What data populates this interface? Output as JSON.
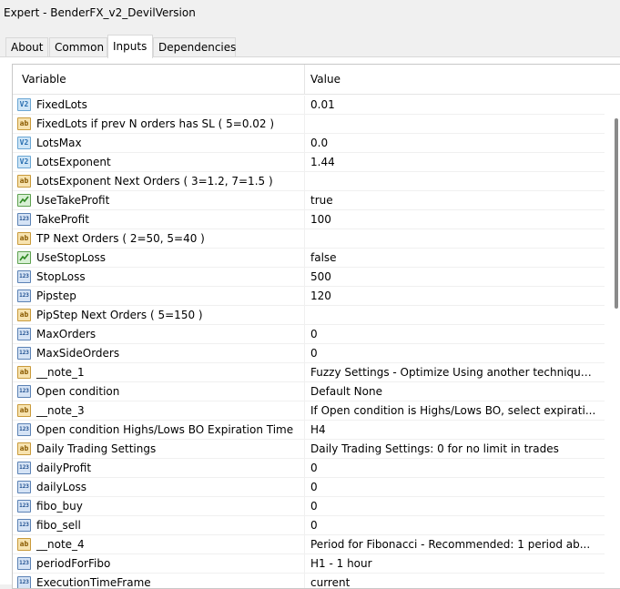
{
  "window": {
    "title": "Expert - BenderFX_v2_DevilVersion"
  },
  "tabs": [
    {
      "label": "About"
    },
    {
      "label": "Common"
    },
    {
      "label": "Inputs"
    },
    {
      "label": "Dependencies"
    }
  ],
  "active_tab": "Inputs",
  "table": {
    "headers": {
      "variable": "Variable",
      "value": "Value"
    },
    "rows": [
      {
        "icon": "double-value-icon",
        "type": "v2",
        "name": "FixedLots",
        "value": "0.01"
      },
      {
        "icon": "string-value-icon",
        "type": "ab",
        "name": "FixedLots if prev N orders has SL ( 5=0.02 )",
        "value": ""
      },
      {
        "icon": "double-value-icon",
        "type": "v2",
        "name": "LotsMax",
        "value": "0.0"
      },
      {
        "icon": "double-value-icon",
        "type": "v2",
        "name": "LotsExponent",
        "value": "1.44"
      },
      {
        "icon": "string-value-icon",
        "type": "ab",
        "name": "LotsExponent Next Orders ( 3=1.2, 7=1.5 )",
        "value": ""
      },
      {
        "icon": "bool-value-icon",
        "type": "bool",
        "name": "UseTakeProfit",
        "value": "true"
      },
      {
        "icon": "int-value-icon",
        "type": "123",
        "name": "TakeProfit",
        "value": "100"
      },
      {
        "icon": "string-value-icon",
        "type": "ab",
        "name": "TP Next Orders ( 2=50, 5=40 )",
        "value": ""
      },
      {
        "icon": "bool-value-icon",
        "type": "bool",
        "name": "UseStopLoss",
        "value": "false"
      },
      {
        "icon": "int-value-icon",
        "type": "123",
        "name": "StopLoss",
        "value": "500"
      },
      {
        "icon": "int-value-icon",
        "type": "123",
        "name": "Pipstep",
        "value": "120"
      },
      {
        "icon": "string-value-icon",
        "type": "ab",
        "name": "PipStep Next Orders ( 5=150 )",
        "value": ""
      },
      {
        "icon": "int-value-icon",
        "type": "123",
        "name": "MaxOrders",
        "value": "0"
      },
      {
        "icon": "int-value-icon",
        "type": "123",
        "name": "MaxSideOrders",
        "value": "0"
      },
      {
        "icon": "string-value-icon",
        "type": "ab",
        "name": "__note_1",
        "value": "Fuzzy Settings - Optimize Using another technique -..."
      },
      {
        "icon": "int-value-icon",
        "type": "123",
        "name": "Open condition",
        "value": "Default None"
      },
      {
        "icon": "string-value-icon",
        "type": "ab",
        "name": "__note_3",
        "value": "If Open condition is Highs/Lows BO, select expirati..."
      },
      {
        "icon": "int-value-icon",
        "type": "123",
        "name": "Open condition Highs/Lows BO Expiration Time",
        "value": "H4"
      },
      {
        "icon": "string-value-icon",
        "type": "ab",
        "name": "Daily Trading Settings",
        "value": "Daily Trading Settings: 0 for no limit in trades"
      },
      {
        "icon": "int-value-icon",
        "type": "123",
        "name": "dailyProfit",
        "value": "0"
      },
      {
        "icon": "int-value-icon",
        "type": "123",
        "name": "dailyLoss",
        "value": "0"
      },
      {
        "icon": "int-value-icon",
        "type": "123",
        "name": "fibo_buy",
        "value": "0"
      },
      {
        "icon": "int-value-icon",
        "type": "123",
        "name": "fibo_sell",
        "value": "0"
      },
      {
        "icon": "string-value-icon",
        "type": "ab",
        "name": "__note_4",
        "value": "Period for Fibonacci - Recommended: 1 period ab..."
      },
      {
        "icon": "int-value-icon",
        "type": "123",
        "name": "periodForFibo",
        "value": "H1 - 1 hour"
      },
      {
        "icon": "int-value-icon",
        "type": "123",
        "name": "ExecutionTimeFrame",
        "value": "current"
      }
    ]
  },
  "icon_glyphs": {
    "v2": "V2",
    "ab": "ab",
    "123": "123"
  },
  "colors": {
    "panel_bg": "#ffffff",
    "window_bg": "#f0f0f0",
    "border": "#c8c8c8"
  }
}
